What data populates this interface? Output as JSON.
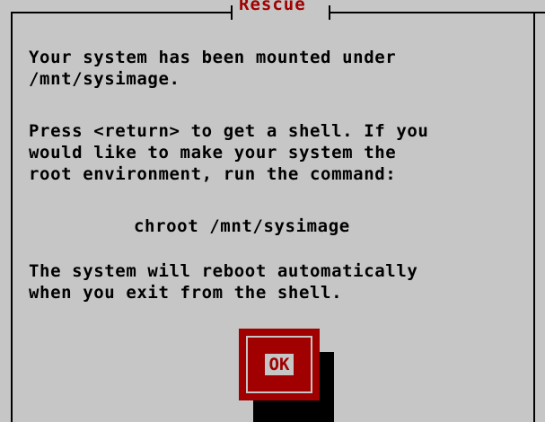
{
  "dialog": {
    "title": "Rescue",
    "paragraph1": [
      "Your system has been mounted under",
      "/mnt/sysimage."
    ],
    "paragraph2": [
      "Press <return> to get a shell. If you",
      "would like to make your system the",
      "root environment, run the command:"
    ],
    "command": "chroot /mnt/sysimage",
    "paragraph3": [
      "The system will reboot automatically",
      "when you exit from the shell."
    ],
    "ok_label": "OK"
  },
  "colors": {
    "background": "#c6c6c6",
    "accent": "#a00000",
    "text": "#000000"
  }
}
